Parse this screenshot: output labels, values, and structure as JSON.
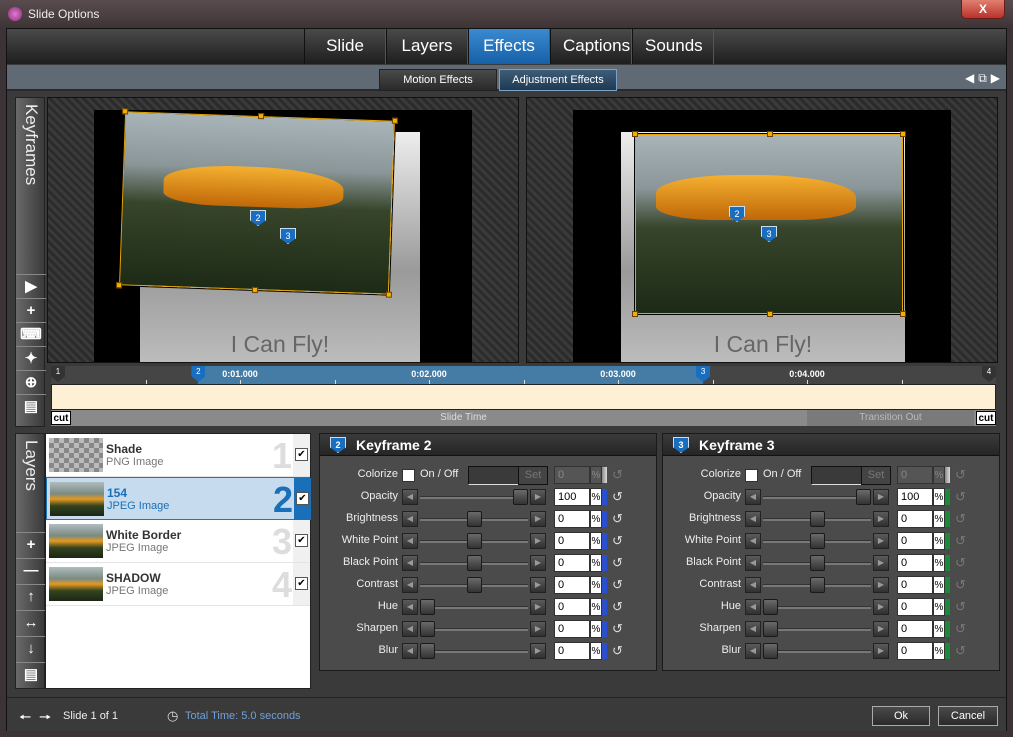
{
  "window": {
    "title": "Slide Options",
    "close_label": "X"
  },
  "tabs": [
    {
      "label": "Slide"
    },
    {
      "label": "Layers"
    },
    {
      "label": "Effects",
      "active": true
    },
    {
      "label": "Captions"
    },
    {
      "label": "Sounds"
    }
  ],
  "subtabs": [
    {
      "label": "Motion Effects"
    },
    {
      "label": "Adjustment Effects",
      "active": true
    }
  ],
  "keyframes_strip": {
    "label": "Keyframes"
  },
  "preview": {
    "caption": "I Can Fly!"
  },
  "timeline": {
    "range_seconds": [
      0,
      5
    ],
    "tick_labels": [
      "0:01.000",
      "0:02.000",
      "0:03.000",
      "0:04.000"
    ],
    "markers": [
      {
        "label": "1",
        "time": 0
      },
      {
        "label": "2",
        "time": 0.78
      },
      {
        "label": "3",
        "time": 3.45
      },
      {
        "label": "4",
        "time": 5.0
      }
    ],
    "selected_range": [
      0.78,
      3.45
    ],
    "transition_out_start": 4.0,
    "slide_time_label": "Slide Time",
    "transition_out_label": "Transition Out",
    "cut_label": "cut"
  },
  "layers_strip": {
    "label": "Layers"
  },
  "layers": [
    {
      "name": "Shade",
      "type": "PNG Image",
      "number": "1",
      "checked": true
    },
    {
      "name": "154",
      "type": "JPEG Image",
      "number": "2",
      "checked": true,
      "selected": true
    },
    {
      "name": "White Border",
      "type": "JPEG Image",
      "number": "3",
      "checked": true
    },
    {
      "name": "SHADOW",
      "type": "JPEG Image",
      "number": "4",
      "checked": true
    }
  ],
  "keyframe_panels": [
    {
      "title": "Keyframe 2",
      "pin": "2",
      "indicator_color": "#2a50d0",
      "reset_enabled": true,
      "colorize": {
        "label": "Colorize",
        "toggle_label": "On / Off",
        "set_label": "Set",
        "value": "0",
        "checked": false
      },
      "rows": [
        {
          "label": "Opacity",
          "value": "100",
          "min": 0,
          "max": 100
        },
        {
          "label": "Brightness",
          "value": "0",
          "min": -100,
          "max": 100
        },
        {
          "label": "White Point",
          "value": "0",
          "min": -100,
          "max": 100
        },
        {
          "label": "Black Point",
          "value": "0",
          "min": -100,
          "max": 100
        },
        {
          "label": "Contrast",
          "value": "0",
          "min": -100,
          "max": 100
        },
        {
          "label": "Hue",
          "value": "0",
          "min": 0,
          "max": 100
        },
        {
          "label": "Sharpen",
          "value": "0",
          "min": 0,
          "max": 100
        },
        {
          "label": "Blur",
          "value": "0",
          "min": 0,
          "max": 100
        }
      ]
    },
    {
      "title": "Keyframe 3",
      "pin": "3",
      "indicator_color": "#1a8a3a",
      "reset_enabled": false,
      "colorize": {
        "label": "Colorize",
        "toggle_label": "On / Off",
        "set_label": "Set",
        "value": "0",
        "checked": false
      },
      "rows": [
        {
          "label": "Opacity",
          "value": "100",
          "min": 0,
          "max": 100
        },
        {
          "label": "Brightness",
          "value": "0",
          "min": -100,
          "max": 100
        },
        {
          "label": "White Point",
          "value": "0",
          "min": -100,
          "max": 100
        },
        {
          "label": "Black Point",
          "value": "0",
          "min": -100,
          "max": 100
        },
        {
          "label": "Contrast",
          "value": "0",
          "min": -100,
          "max": 100
        },
        {
          "label": "Hue",
          "value": "0",
          "min": 0,
          "max": 100
        },
        {
          "label": "Sharpen",
          "value": "0",
          "min": 0,
          "max": 100
        },
        {
          "label": "Blur",
          "value": "0",
          "min": 0,
          "max": 100
        }
      ]
    }
  ],
  "footer": {
    "slide_label": "Slide 1 of 1",
    "total_time": "Total Time: 5.0 seconds",
    "ok_label": "Ok",
    "cancel_label": "Cancel"
  },
  "pct_label": "%"
}
